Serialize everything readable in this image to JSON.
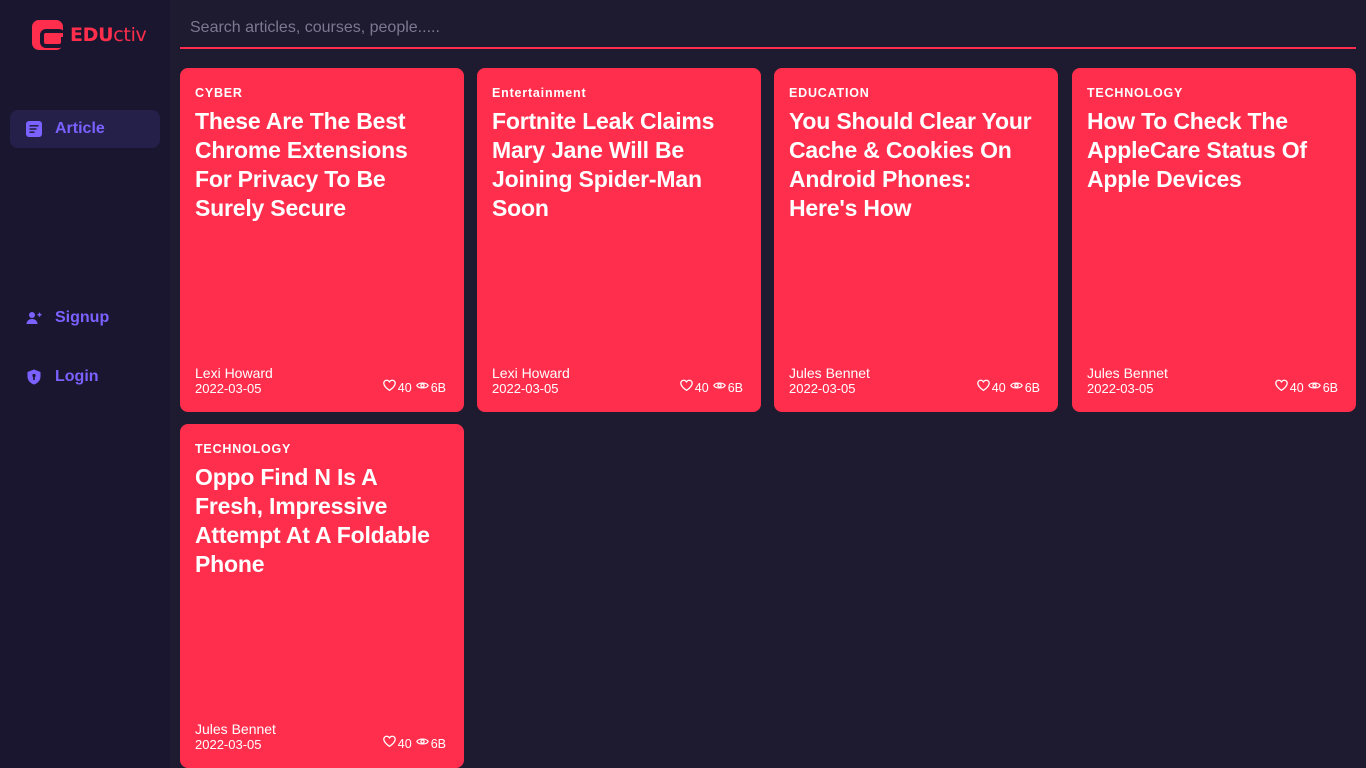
{
  "brand": {
    "bold": "EDU",
    "rest": "ctiv"
  },
  "search": {
    "placeholder": "Search articles, courses, people....."
  },
  "nav": {
    "article": "Article",
    "signup": "Signup",
    "login": "Login"
  },
  "cards": [
    {
      "category": "CYBER",
      "title": "These Are The Best Chrome Extensions For Privacy To Be Surely Secure",
      "author": "Lexi Howard",
      "date": "2022-03-05",
      "likes": "40",
      "views": "6B"
    },
    {
      "category": "Entertainment",
      "title": "Fortnite Leak Claims Mary Jane Will Be Joining Spider-Man Soon",
      "author": "Lexi Howard",
      "date": "2022-03-05",
      "likes": "40",
      "views": "6B"
    },
    {
      "category": "EDUCATION",
      "title": "You Should Clear Your Cache & Cookies On Android Phones: Here's How",
      "author": "Jules Bennet",
      "date": "2022-03-05",
      "likes": "40",
      "views": "6B"
    },
    {
      "category": "TECHNOLOGY",
      "title": "How To Check The AppleCare Status Of Apple Devices",
      "author": "Jules Bennet",
      "date": "2022-03-05",
      "likes": "40",
      "views": "6B"
    },
    {
      "category": "TECHNOLOGY",
      "title": "Oppo Find N Is A Fresh, Impressive Attempt At A Foldable Phone",
      "author": "Jules Bennet",
      "date": "2022-03-05",
      "likes": "40",
      "views": "6B"
    }
  ],
  "icons": {
    "article": "article-icon",
    "signup": "user-plus-icon",
    "login": "shield-icon",
    "like": "heart-icon",
    "views": "eye-icon"
  },
  "colors": {
    "accent": "#ff2e4d",
    "nav": "#7b61ff",
    "background": "#1e1b30",
    "sidebar": "#1a1630"
  }
}
